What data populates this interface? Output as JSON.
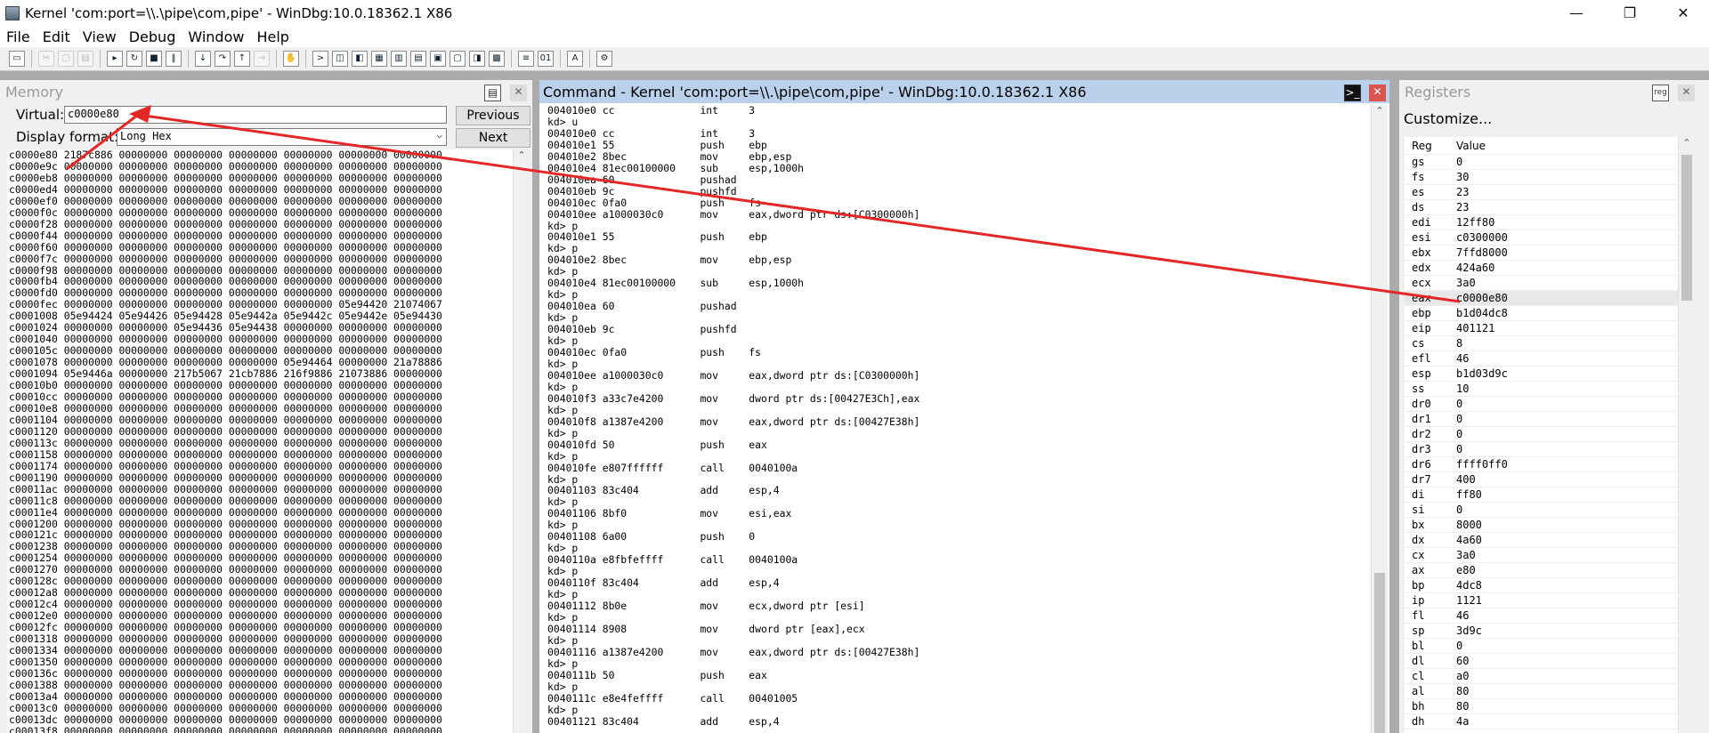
{
  "window": {
    "title": "Kernel 'com:port=\\\\.\\pipe\\com,pipe' - WinDbg:10.0.18362.1 X86",
    "minimize": "—",
    "maximize": "❐",
    "close": "✕"
  },
  "menu": [
    "File",
    "Edit",
    "View",
    "Debug",
    "Window",
    "Help"
  ],
  "memory": {
    "title": "Memory",
    "virtual_label": "Virtual:",
    "virtual_value": "c0000e80",
    "format_label": "Display format:",
    "format_value": "Long Hex",
    "previous": "Previous",
    "next": "Next",
    "lines": [
      "c0000e80 2187c886 00000000 00000000 00000000 00000000 00000000 00000000",
      "c0000e9c 00000000 00000000 00000000 00000000 00000000 00000000 00000000",
      "c0000eb8 00000000 00000000 00000000 00000000 00000000 00000000 00000000",
      "c0000ed4 00000000 00000000 00000000 00000000 00000000 00000000 00000000",
      "c0000ef0 00000000 00000000 00000000 00000000 00000000 00000000 00000000",
      "c0000f0c 00000000 00000000 00000000 00000000 00000000 00000000 00000000",
      "c0000f28 00000000 00000000 00000000 00000000 00000000 00000000 00000000",
      "c0000f44 00000000 00000000 00000000 00000000 00000000 00000000 00000000",
      "c0000f60 00000000 00000000 00000000 00000000 00000000 00000000 00000000",
      "c0000f7c 00000000 00000000 00000000 00000000 00000000 00000000 00000000",
      "c0000f98 00000000 00000000 00000000 00000000 00000000 00000000 00000000",
      "c0000fb4 00000000 00000000 00000000 00000000 00000000 00000000 00000000",
      "c0000fd0 00000000 00000000 00000000 00000000 00000000 00000000 00000000",
      "c0000fec 00000000 00000000 00000000 00000000 00000000 05e94420 21074067",
      "c0001008 05e94424 05e94426 05e94428 05e9442a 05e9442c 05e9442e 05e94430",
      "c0001024 00000000 00000000 05e94436 05e94438 00000000 00000000 00000000",
      "c0001040 00000000 00000000 00000000 00000000 00000000 00000000 00000000",
      "c000105c 00000000 00000000 00000000 00000000 00000000 00000000 00000000",
      "c0001078 00000000 00000000 00000000 00000000 05e94464 00000000 21a78886",
      "c0001094 05e9446a 00000000 217b5067 21cb7886 216f9886 21073886 00000000",
      "c00010b0 00000000 00000000 00000000 00000000 00000000 00000000 00000000",
      "c00010cc 00000000 00000000 00000000 00000000 00000000 00000000 00000000",
      "c00010e8 00000000 00000000 00000000 00000000 00000000 00000000 00000000",
      "c0001104 00000000 00000000 00000000 00000000 00000000 00000000 00000000",
      "c0001120 00000000 00000000 00000000 00000000 00000000 00000000 00000000",
      "c000113c 00000000 00000000 00000000 00000000 00000000 00000000 00000000",
      "c0001158 00000000 00000000 00000000 00000000 00000000 00000000 00000000",
      "c0001174 00000000 00000000 00000000 00000000 00000000 00000000 00000000",
      "c0001190 00000000 00000000 00000000 00000000 00000000 00000000 00000000",
      "c00011ac 00000000 00000000 00000000 00000000 00000000 00000000 00000000",
      "c00011c8 00000000 00000000 00000000 00000000 00000000 00000000 00000000",
      "c00011e4 00000000 00000000 00000000 00000000 00000000 00000000 00000000",
      "c0001200 00000000 00000000 00000000 00000000 00000000 00000000 00000000",
      "c000121c 00000000 00000000 00000000 00000000 00000000 00000000 00000000",
      "c0001238 00000000 00000000 00000000 00000000 00000000 00000000 00000000",
      "c0001254 00000000 00000000 00000000 00000000 00000000 00000000 00000000",
      "c0001270 00000000 00000000 00000000 00000000 00000000 00000000 00000000",
      "c000128c 00000000 00000000 00000000 00000000 00000000 00000000 00000000",
      "c00012a8 00000000 00000000 00000000 00000000 00000000 00000000 00000000",
      "c00012c4 00000000 00000000 00000000 00000000 00000000 00000000 00000000",
      "c00012e0 00000000 00000000 00000000 00000000 00000000 00000000 00000000",
      "c00012fc 00000000 00000000 00000000 00000000 00000000 00000000 00000000",
      "c0001318 00000000 00000000 00000000 00000000 00000000 00000000 00000000",
      "c0001334 00000000 00000000 00000000 00000000 00000000 00000000 00000000",
      "c0001350 00000000 00000000 00000000 00000000 00000000 00000000 00000000",
      "c000136c 00000000 00000000 00000000 00000000 00000000 00000000 00000000",
      "c0001388 00000000 00000000 00000000 00000000 00000000 00000000 00000000",
      "c00013a4 00000000 00000000 00000000 00000000 00000000 00000000 00000000",
      "c00013c0 00000000 00000000 00000000 00000000 00000000 00000000 00000000",
      "c00013dc 00000000 00000000 00000000 00000000 00000000 00000000 00000000",
      "c00013f8 00000000 00000000 00000000 00000000 00000000 00000000 00000000"
    ]
  },
  "command": {
    "title": "Command - Kernel 'com:port=\\\\.\\pipe\\com,pipe' - WinDbg:10.0.18362.1 X86",
    "lines": [
      "004010e0 cc              int     3",
      "kd> u",
      "004010e0 cc              int     3",
      "004010e1 55              push    ebp",
      "004010e2 8bec            mov     ebp,esp",
      "004010e4 81ec00100000    sub     esp,1000h",
      "004010ea 60              pushad",
      "004010eb 9c              pushfd",
      "004010ec 0fa0            push    fs",
      "004010ee a1000030c0      mov     eax,dword ptr ds:[C0300000h]",
      "kd> p",
      "004010e1 55              push    ebp",
      "kd> p",
      "004010e2 8bec            mov     ebp,esp",
      "kd> p",
      "004010e4 81ec00100000    sub     esp,1000h",
      "kd> p",
      "004010ea 60              pushad",
      "kd> p",
      "004010eb 9c              pushfd",
      "kd> p",
      "004010ec 0fa0            push    fs",
      "kd> p",
      "004010ee a1000030c0      mov     eax,dword ptr ds:[C0300000h]",
      "kd> p",
      "004010f3 a33c7e4200      mov     dword ptr ds:[00427E3Ch],eax",
      "kd> p",
      "004010f8 a1387e4200      mov     eax,dword ptr ds:[00427E38h]",
      "kd> p",
      "004010fd 50              push    eax",
      "kd> p",
      "004010fe e807ffffff      call    0040100a",
      "kd> p",
      "00401103 83c404          add     esp,4",
      "kd> p",
      "00401106 8bf0            mov     esi,eax",
      "kd> p",
      "00401108 6a00            push    0",
      "kd> p",
      "0040110a e8fbfeffff      call    0040100a",
      "kd> p",
      "0040110f 83c404          add     esp,4",
      "kd> p",
      "00401112 8b0e            mov     ecx,dword ptr [esi]",
      "kd> p",
      "00401114 8908            mov     dword ptr [eax],ecx",
      "kd> p",
      "00401116 a1387e4200      mov     eax,dword ptr ds:[00427E38h]",
      "kd> p",
      "0040111b 50              push    eax",
      "kd> p",
      "0040111c e8e4feffff      call    00401005",
      "kd> p",
      "00401121 83c404          add     esp,4"
    ]
  },
  "registers": {
    "title": "Registers",
    "customize": "Customize...",
    "col_reg": "Reg",
    "col_value": "Value",
    "rows": [
      [
        "gs",
        "0"
      ],
      [
        "fs",
        "30"
      ],
      [
        "es",
        "23"
      ],
      [
        "ds",
        "23"
      ],
      [
        "edi",
        "12ff80"
      ],
      [
        "esi",
        "c0300000"
      ],
      [
        "ebx",
        "7ffd8000"
      ],
      [
        "edx",
        "424a60"
      ],
      [
        "ecx",
        "3a0"
      ],
      [
        "eax",
        "c0000e80"
      ],
      [
        "ebp",
        "b1d04dc8"
      ],
      [
        "eip",
        "401121"
      ],
      [
        "cs",
        "8"
      ],
      [
        "efl",
        "46"
      ],
      [
        "esp",
        "b1d03d9c"
      ],
      [
        "ss",
        "10"
      ],
      [
        "dr0",
        "0"
      ],
      [
        "dr1",
        "0"
      ],
      [
        "dr2",
        "0"
      ],
      [
        "dr3",
        "0"
      ],
      [
        "dr6",
        "ffff0ff0"
      ],
      [
        "dr7",
        "400"
      ],
      [
        "di",
        "ff80"
      ],
      [
        "si",
        "0"
      ],
      [
        "bx",
        "8000"
      ],
      [
        "dx",
        "4a60"
      ],
      [
        "cx",
        "3a0"
      ],
      [
        "ax",
        "e80"
      ],
      [
        "bp",
        "4dc8"
      ],
      [
        "ip",
        "1121"
      ],
      [
        "fl",
        "46"
      ],
      [
        "sp",
        "3d9c"
      ],
      [
        "bl",
        "0"
      ],
      [
        "dl",
        "60"
      ],
      [
        "cl",
        "a0"
      ],
      [
        "al",
        "80"
      ],
      [
        "bh",
        "80"
      ],
      [
        "dh",
        "4a"
      ]
    ]
  },
  "annotation_color": "#e32727"
}
